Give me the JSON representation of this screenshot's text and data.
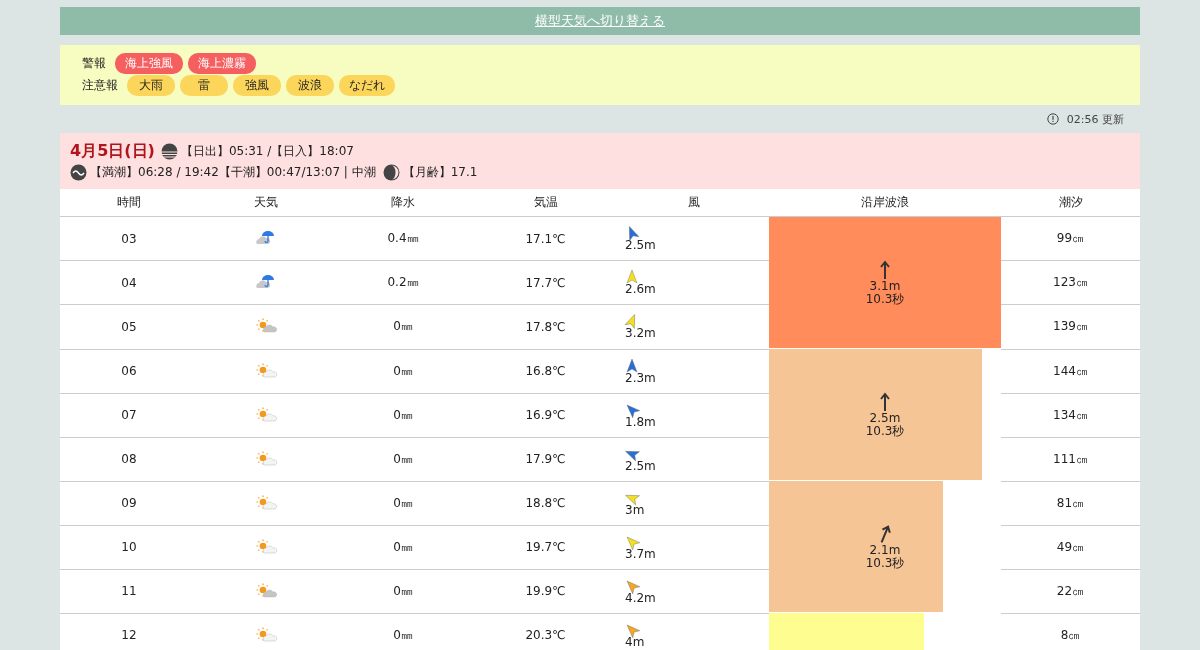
{
  "switch_link": "横型天気へ切り替える",
  "alerts": [
    {
      "label": "警報",
      "kind": "warning",
      "items": [
        "海上強風",
        "海上濃霧"
      ]
    },
    {
      "label": "注意報",
      "kind": "advisory",
      "items": [
        "大雨",
        "雷",
        "強風",
        "波浪",
        "なだれ"
      ]
    }
  ],
  "updated": "02:56 更新",
  "day": {
    "date": "4月5日(日)",
    "sun": "【日出】05:31 /【日入】18:07",
    "tide": "【満潮】06:28 / 19:42【干潮】00:47/13:07 | 中潮",
    "moon": "【月齢】17.1"
  },
  "table": {
    "columns": [
      "時間",
      "天気",
      "降水",
      "気温",
      "風",
      "沿岸波浪",
      "潮汐"
    ],
    "groups": [
      {
        "wave": {
          "height": "3.1m",
          "period": "10.3秒",
          "kind": "n",
          "color": "#ff8c5a",
          "level": 1
        },
        "rows": [
          {
            "hour": "03",
            "weather": {
              "kind": "rain"
            },
            "precip": "0.4㎜",
            "temp": "17.1℃",
            "wind": {
              "kind": "nnw",
              "color": "#2a6fd6",
              "speed": "2.5m"
            },
            "tide": "99㎝"
          },
          {
            "hour": "04",
            "weather": {
              "kind": "rain"
            },
            "precip": "0.2㎜",
            "temp": "17.7℃",
            "wind": {
              "kind": "n",
              "color": "#f5e020",
              "speed": "2.6m"
            },
            "tide": "123㎝"
          },
          {
            "hour": "05",
            "weather": {
              "kind": "sungray"
            },
            "precip": "0㎜",
            "temp": "17.8℃",
            "wind": {
              "kind": "nne",
              "color": "#f5e020",
              "speed": "3.2m"
            },
            "tide": "139㎝"
          }
        ]
      },
      {
        "wave": {
          "height": "2.5m",
          "period": "10.3秒",
          "kind": "n",
          "color": "#f5c596",
          "level": 0.92
        },
        "rows": [
          {
            "hour": "06",
            "weather": {
              "kind": "suncloud"
            },
            "precip": "0㎜",
            "temp": "16.8℃",
            "wind": {
              "kind": "n",
              "color": "#2a6fd6",
              "speed": "2.3m"
            },
            "tide": "144㎝"
          },
          {
            "hour": "07",
            "weather": {
              "kind": "suncloud"
            },
            "precip": "0㎜",
            "temp": "16.9℃",
            "wind": {
              "kind": "nw",
              "color": "#2a6fd6",
              "speed": "1.8m"
            },
            "tide": "134㎝"
          },
          {
            "hour": "08",
            "weather": {
              "kind": "suncloud"
            },
            "precip": "0㎜",
            "temp": "17.9℃",
            "wind": {
              "kind": "wnw",
              "color": "#2a6fd6",
              "speed": "2.5m"
            },
            "tide": "111㎝"
          }
        ]
      },
      {
        "wave": {
          "height": "2.1m",
          "period": "10.3秒",
          "kind": "nne",
          "color": "#f5c596",
          "level": 0.75
        },
        "rows": [
          {
            "hour": "09",
            "weather": {
              "kind": "suncloud"
            },
            "precip": "0㎜",
            "temp": "18.8℃",
            "wind": {
              "kind": "wnw",
              "color": "#f5e020",
              "speed": "3m"
            },
            "tide": "81㎝"
          },
          {
            "hour": "10",
            "weather": {
              "kind": "suncloud"
            },
            "precip": "0㎜",
            "temp": "19.7℃",
            "wind": {
              "kind": "nw",
              "color": "#f5e020",
              "speed": "3.7m"
            },
            "tide": "49㎝"
          },
          {
            "hour": "11",
            "weather": {
              "kind": "sungray"
            },
            "precip": "0㎜",
            "temp": "19.9℃",
            "wind": {
              "kind": "nw",
              "color": "#f5a623",
              "speed": "4.2m"
            },
            "tide": "22㎝"
          }
        ]
      },
      {
        "wave": {
          "color": "#fdfd90",
          "level": 0.67
        },
        "rows": [
          {
            "hour": "12",
            "weather": {
              "kind": "suncloud"
            },
            "precip": "0㎜",
            "temp": "20.3℃",
            "wind": {
              "kind": "nw",
              "color": "#f5a623",
              "speed": "4m"
            },
            "tide": "8㎝"
          }
        ]
      }
    ]
  }
}
